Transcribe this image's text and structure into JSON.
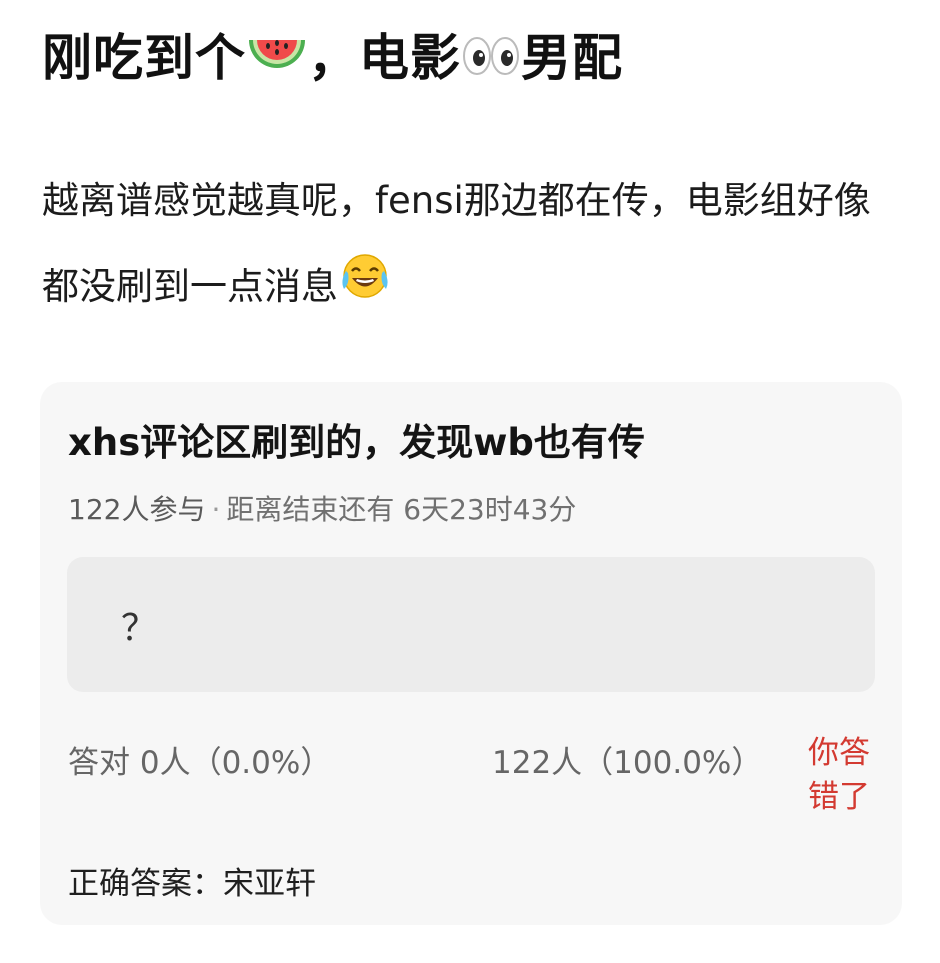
{
  "post": {
    "title_part1": "刚吃到个",
    "title_emoji1": "watermelon-icon",
    "title_part2": "，电影",
    "title_emoji2": "eyes-icon",
    "title_part3": "男配",
    "body_text": "越离谱感觉越真呢，fensi那边都在传，电影组好像都没刷到一点消息",
    "body_emoji": "tears-of-joy-icon"
  },
  "poll": {
    "title": "xhs评论区刷到的，发现wb也有传",
    "participants": "122人参与",
    "separator": "·",
    "countdown": "距离结束还有 6天23时43分",
    "option_text": "？",
    "correct_label": "答对  0人（0.0%）",
    "wrong_label": "122人（100.0%）",
    "your_result": "你答错了",
    "answer_label": "正确答案：",
    "answer_value": "宋亚轩"
  },
  "colors": {
    "card_bg": "#f7f7f7",
    "option_bg": "#ececec",
    "wrong_red": "#d33a31",
    "meta_gray": "#5a5a5a"
  }
}
